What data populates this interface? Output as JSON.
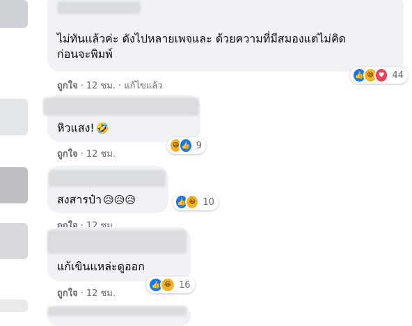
{
  "comments": [
    {
      "text_line1": "ไม่ทันแล้วค่ะ ดังไปหลายเพจและ ด้วยความที่มีสมองแต่ไม่คิด",
      "text_line2": "ก่อนจะพิมพ์",
      "like": "ถูกใจ",
      "time": "12 ชม.",
      "edited": "แก้ไขแล้ว",
      "reaction_count": "44",
      "reactions": [
        "like-icon",
        "haha-icon",
        "love-icon"
      ]
    },
    {
      "text": "หิวแสง!",
      "emoji": "🤣",
      "like": "ถูกใจ",
      "time": "12 ชม.",
      "reaction_count": "9",
      "reactions": [
        "haha-icon",
        "like-icon"
      ]
    },
    {
      "text": "สงสารป๋า",
      "emoji": "😥😥😥",
      "like": "ถูกใจ",
      "time": "12 ชม.",
      "reaction_count": "10",
      "reactions": [
        "like-icon",
        "haha-icon"
      ]
    },
    {
      "text": "แก้เขินแหล่ะดูออก",
      "like": "ถูกใจ",
      "time": "12 ชม.",
      "reaction_count": "16",
      "reactions": [
        "like-icon",
        "haha-icon"
      ]
    }
  ],
  "icons": {
    "like": "👍",
    "haha": "😆",
    "love": "♥"
  },
  "colors": {
    "bubble": "#f0f2f5",
    "meta": "#65676b",
    "like": "#1877f2",
    "haha": "#f7b125",
    "love": "#f33e58"
  }
}
